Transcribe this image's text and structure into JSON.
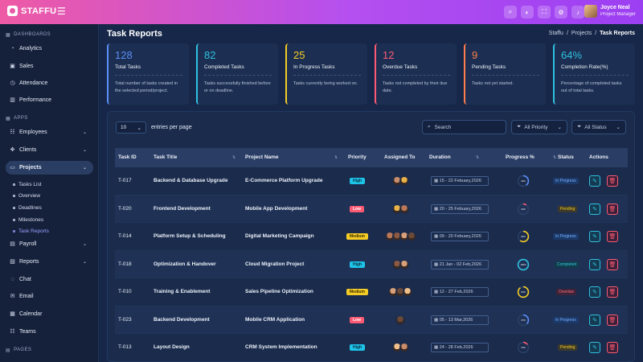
{
  "app": {
    "brand": "STAFFU"
  },
  "user": {
    "name": "Joyce Neal",
    "role": "Project Manager"
  },
  "header_icons": [
    "search-icon",
    "theme-icon",
    "fullscreen-icon",
    "settings-icon",
    "bell-icon"
  ],
  "sidebar": {
    "sections": {
      "dashboards": "DASHBOARDS",
      "apps": "APPS",
      "pages": "PAGES"
    },
    "dashboards": [
      {
        "label": "Analytics",
        "icon": "chart-icon"
      },
      {
        "label": "Sales",
        "icon": "store-icon"
      },
      {
        "label": "Attendance",
        "icon": "clock-icon"
      },
      {
        "label": "Performance",
        "icon": "bars-icon"
      }
    ],
    "apps": [
      {
        "label": "Employees",
        "icon": "users-icon",
        "chevron": true
      },
      {
        "label": "Clients",
        "icon": "handshake-icon",
        "chevron": true
      },
      {
        "label": "Projects",
        "icon": "folder-icon",
        "chevron": true,
        "active": true
      },
      {
        "label": "Payroll",
        "icon": "wallet-icon",
        "chevron": true
      },
      {
        "label": "Reports",
        "icon": "report-icon",
        "chevron": true
      },
      {
        "label": "Chat",
        "icon": "chat-icon"
      },
      {
        "label": "Email",
        "icon": "mail-icon"
      },
      {
        "label": "Calendar",
        "icon": "calendar-icon"
      },
      {
        "label": "Teams",
        "icon": "team-icon"
      }
    ],
    "project_subitems": [
      {
        "label": "Tasks List"
      },
      {
        "label": "Overview"
      },
      {
        "label": "Deadlines"
      },
      {
        "label": "Milestones"
      },
      {
        "label": "Task Reports",
        "active": true
      }
    ]
  },
  "page": {
    "title": "Task Reports",
    "breadcrumb": [
      "Staffu",
      "Projects",
      "Task Reports"
    ]
  },
  "stats": [
    {
      "value": "128",
      "label": "Total Tasks",
      "desc": "Total number of tasks created in the selected period/project.",
      "color": "#5b8ef7"
    },
    {
      "value": "82",
      "label": "Completed Tasks",
      "desc": "Tasks successfully finished before or on deadline.",
      "color": "#2fc1df"
    },
    {
      "value": "25",
      "label": "In Progress Tasks",
      "desc": "Tasks currently being worked on.",
      "color": "#f5cc25"
    },
    {
      "value": "12",
      "label": "Overdue Tasks",
      "desc": "Tasks not completed by their due date.",
      "color": "#ff5a73"
    },
    {
      "value": "9",
      "label": "Pending Tasks",
      "desc": "Tasks not yet started.",
      "color": "#ff7d4a"
    },
    {
      "value": "64%",
      "label": "Completion Rate(%)",
      "desc": "Percentage of completed tasks out of total tasks.",
      "color": "#2fc1df"
    }
  ],
  "table": {
    "entries_value": "10",
    "entries_label": "entries per page",
    "search_placeholder": "Search",
    "filter_priority": "All Priority",
    "filter_status": "All Status",
    "columns": [
      "Task ID",
      "Task Title",
      "Project Name",
      "Priority",
      "Assigned To",
      "Duration",
      "Progress %",
      "Status",
      "Actions"
    ],
    "rows": [
      {
        "id": "T-017",
        "title": "Backend & Database Upgrade",
        "project": "E-Commerce Platform Upgrade",
        "priority": "High",
        "assignees": 2,
        "duration": "15 - 22 Febuary,2026",
        "progress": 40,
        "progress_label": "40%",
        "status": "In Progress"
      },
      {
        "id": "T-020",
        "title": "Frontend Development",
        "project": "Mobile App Development",
        "priority": "Low",
        "assignees": 2,
        "duration": "20 - 25 Febuary,2026",
        "progress": 10,
        "progress_label": "10%",
        "status": "Pending"
      },
      {
        "id": "T-014",
        "title": "Platform Setup & Scheduling",
        "project": "Digital Marketing Campaign",
        "priority": "Medium",
        "assignees": 4,
        "duration": "09 - 20 Febuary,2026",
        "progress": 60,
        "progress_label": "60%",
        "status": "In Progress"
      },
      {
        "id": "T-018",
        "title": "Optimization & Handover",
        "project": "Cloud Migration Project",
        "priority": "High",
        "assignees": 2,
        "duration": "21 Jan - 02 Feb,2026",
        "progress": 100,
        "progress_label": "100%",
        "status": "Completed"
      },
      {
        "id": "T-010",
        "title": "Training & Enablement",
        "project": "Sales Pipeline Optimization",
        "priority": "Medium",
        "assignees": 3,
        "duration": "12 - 27 Feb,2026",
        "progress": 90,
        "progress_label": "90%",
        "status": "Overdue"
      },
      {
        "id": "T-023",
        "title": "Backend Development",
        "project": "Mobile CRM Application",
        "priority": "Low",
        "assignees": 1,
        "duration": "05 - 13 Mar,2026",
        "progress": 37,
        "progress_label": "37%",
        "status": "In Progress"
      },
      {
        "id": "T-013",
        "title": "Layout Design",
        "project": "CRM System Implementation",
        "priority": "High",
        "assignees": 2,
        "duration": "24 - 28 Feb,2026",
        "progress": 15,
        "progress_label": "15%",
        "status": "Pending"
      }
    ]
  },
  "colors": {
    "high": "#1ec3e8",
    "low": "#ff5a73",
    "medium": "#f5cc25",
    "accent": "#9aa2ff"
  }
}
